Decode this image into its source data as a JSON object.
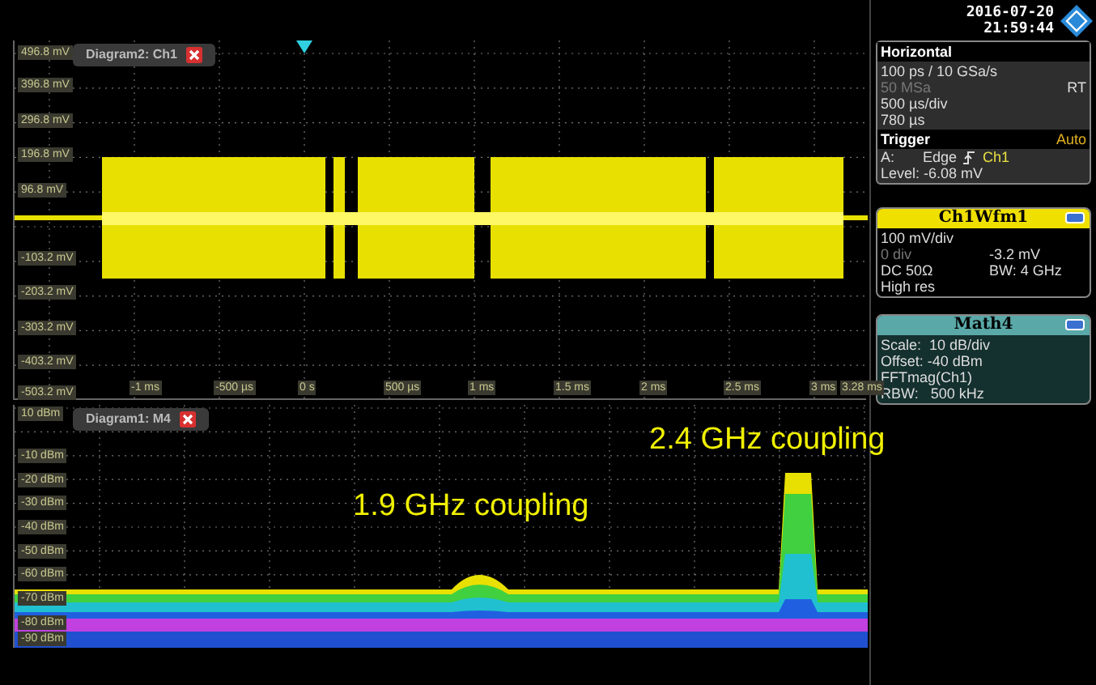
{
  "upper_diagram": {
    "tab": "Diagram2: Ch1",
    "y_axis_labels": [
      "496.8 mV",
      "396.8 mV",
      "296.8 mV",
      "196.8 mV",
      "96.8 mV",
      "-103.2 mV",
      "-203.2 mV",
      "-303.2 mV",
      "-403.2 mV",
      "-503.2 mV"
    ],
    "x_axis_labels": [
      "-1 ms",
      "-500 µs",
      "0 s",
      "500 µs",
      "1 ms",
      "1.5 ms",
      "2 ms",
      "2.5 ms",
      "3 ms",
      "3.28 ms"
    ]
  },
  "lower_diagram": {
    "tab": "Diagram1: M4",
    "y_axis_labels": [
      "10 dBm",
      "-10 dBm",
      "-20 dBm",
      "-30 dBm",
      "-40 dBm",
      "-50 dBm",
      "-60 dBm",
      "-70 dBm",
      "-80 dBm",
      "-90 dBm"
    ],
    "annotations": [
      "1.9 GHz coupling",
      "2.4 GHz coupling"
    ]
  },
  "datetime": {
    "date": "2016-07-20",
    "time": "21:59:44"
  },
  "horizontal": {
    "title": "Horizontal",
    "rows": [
      {
        "left": "100 ps / 10 GSa/s",
        "dimmed": false
      },
      {
        "left": "50 MSa",
        "right": "RT",
        "dimmed": true
      },
      {
        "left": "500 µs/div",
        "dimmed": false
      },
      {
        "left": "780 µs",
        "dimmed": false
      }
    ]
  },
  "trigger": {
    "title": "Trigger",
    "mode": "Auto",
    "source_label": "A:",
    "type": "Edge",
    "source": "Ch1",
    "level": "Level: -6.08 mV"
  },
  "channel": {
    "title": "Ch1Wfm1",
    "rows": [
      {
        "left": "100 mV/div",
        "dimmed": false
      },
      {
        "left": "0 div",
        "right": "-3.2 mV",
        "dimmed": true
      },
      {
        "left": "DC 50Ω",
        "right": "BW: 4 GHz",
        "dimmed": false
      },
      {
        "left": "High res",
        "dimmed": false
      }
    ]
  },
  "math": {
    "title": "Math4",
    "rows": [
      "Scale:  10 dB/div",
      "Offset: -40 dBm",
      "FFTmag(Ch1)",
      "RBW:   500 kHz"
    ]
  }
}
